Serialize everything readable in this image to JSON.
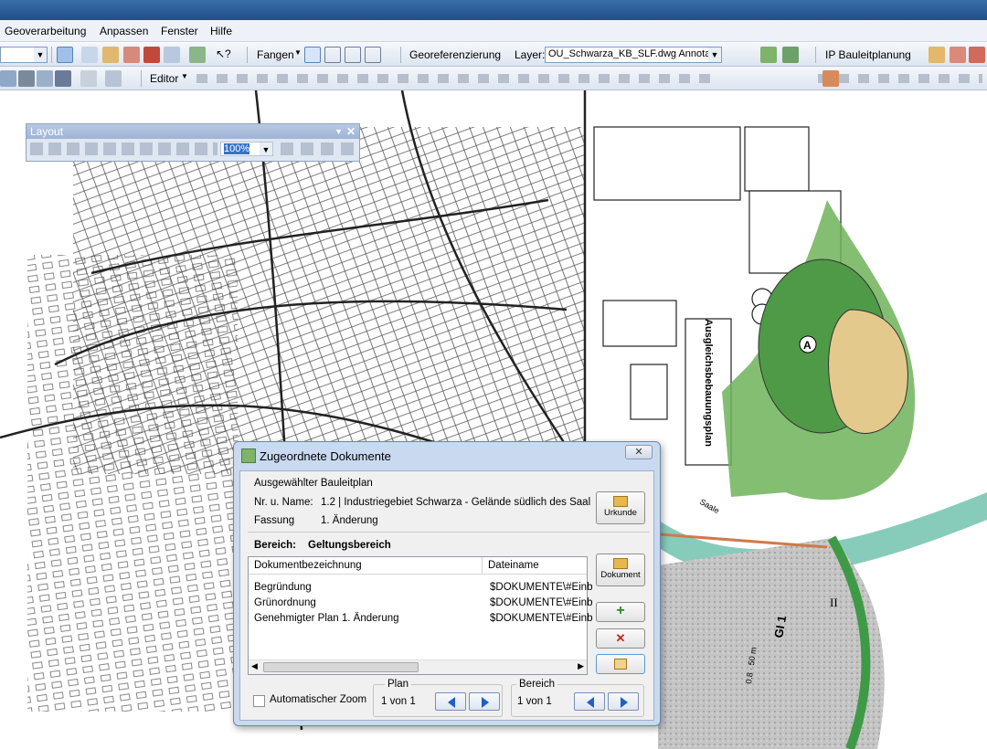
{
  "menu": [
    "Geoverarbeitung",
    "Anpassen",
    "Fenster",
    "Hilfe"
  ],
  "toolbar1": {
    "fangen_label": "Fangen",
    "georef_label": "Georeferenzierung",
    "layer_label": "Layer:",
    "layer_value": "OU_Schwarza_KB_SLF.dwg Annota",
    "ip_label": "IP Bauleitplanung"
  },
  "toolbar2": {
    "editor_label": "Editor"
  },
  "layout": {
    "title": "Layout",
    "zoom_value": "100%"
  },
  "map_labels": {
    "a": "A",
    "plan_text": "Ausgleichsbebauungsplan",
    "gi": "GI 1",
    "ii": "II",
    "ht": "0.8 · 50 m",
    "saale": "Saale"
  },
  "dialog": {
    "title": "Zugeordnete Dokumente",
    "group_label": "Ausgewählter Bauleitplan",
    "nr_label": "Nr. u. Name:",
    "nr_value": "1.2 | Industriegebiet Schwarza - Gelände südlich des Saal",
    "fassung_label": "Fassung",
    "fassung_value": "1. Änderung",
    "urkunde_button": "Urkunde",
    "bereich_label": "Bereich:",
    "bereich_value": "Geltungsbereich",
    "col1": "Dokumentbezeichnung",
    "col2": "Dateiname",
    "rows": [
      {
        "name": "Begründung",
        "file": "$DOKUMENTE\\#Einb"
      },
      {
        "name": "Grünordnung",
        "file": "$DOKUMENTE\\#Einb"
      },
      {
        "name": "Genehmigter Plan 1. Änderung",
        "file": "$DOKUMENTE\\#Einb"
      }
    ],
    "dokument_button": "Dokument",
    "auto_zoom_label": "Automatischer Zoom",
    "plan_label": "Plan",
    "plan_value": "1 von 1",
    "bereich_nav_label": "Bereich",
    "bereich_nav_value": "1 von 1"
  },
  "colors": {
    "green": "#6fb35a",
    "sand": "#e4c98c",
    "gray": "#c6c6c6",
    "accent": "#1f4f8a"
  }
}
